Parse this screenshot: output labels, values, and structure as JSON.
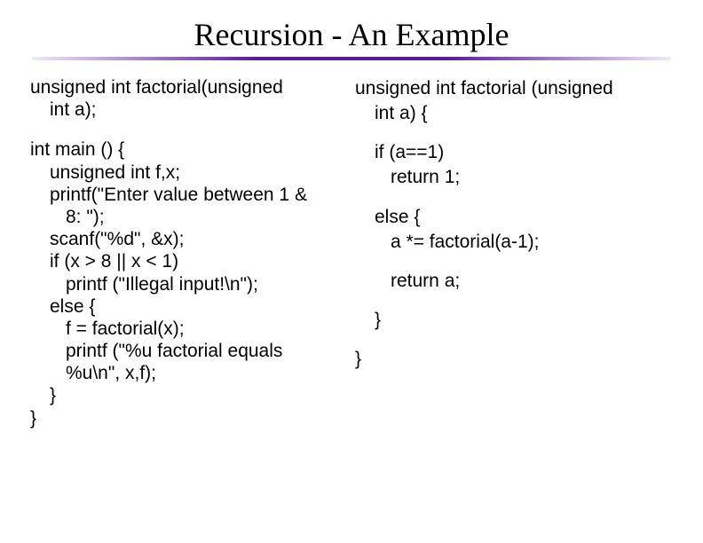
{
  "title": "Recursion - An Example",
  "left": {
    "proto_l1": "unsigned int factorial(unsigned",
    "proto_l2": "int a);",
    "main_open": "int main () {",
    "decl": "unsigned int f,x;",
    "printf1a": "printf(\"Enter value between 1 &",
    "printf1b": "8: \");",
    "scanf": "scanf(\"%d\", &x);",
    "if": "if (x > 8 || x < 1)",
    "printf2": "printf (\"Illegal input!\\n\");",
    "else": "else {",
    "assign": "f = factorial(x);",
    "printf3a": "printf (\"%u factorial equals",
    "printf3b": "%u\\n\", x,f);",
    "close_inner": "}",
    "close_main": "}"
  },
  "right": {
    "sig_l1": "unsigned int factorial (unsigned",
    "sig_l2": "int a) {",
    "if": "if (a==1)",
    "ret1": "return 1;",
    "else": "else {",
    "mul": "a *= factorial(a-1);",
    "reta": "return a;",
    "close_inner": "}",
    "close_fn": "}"
  }
}
